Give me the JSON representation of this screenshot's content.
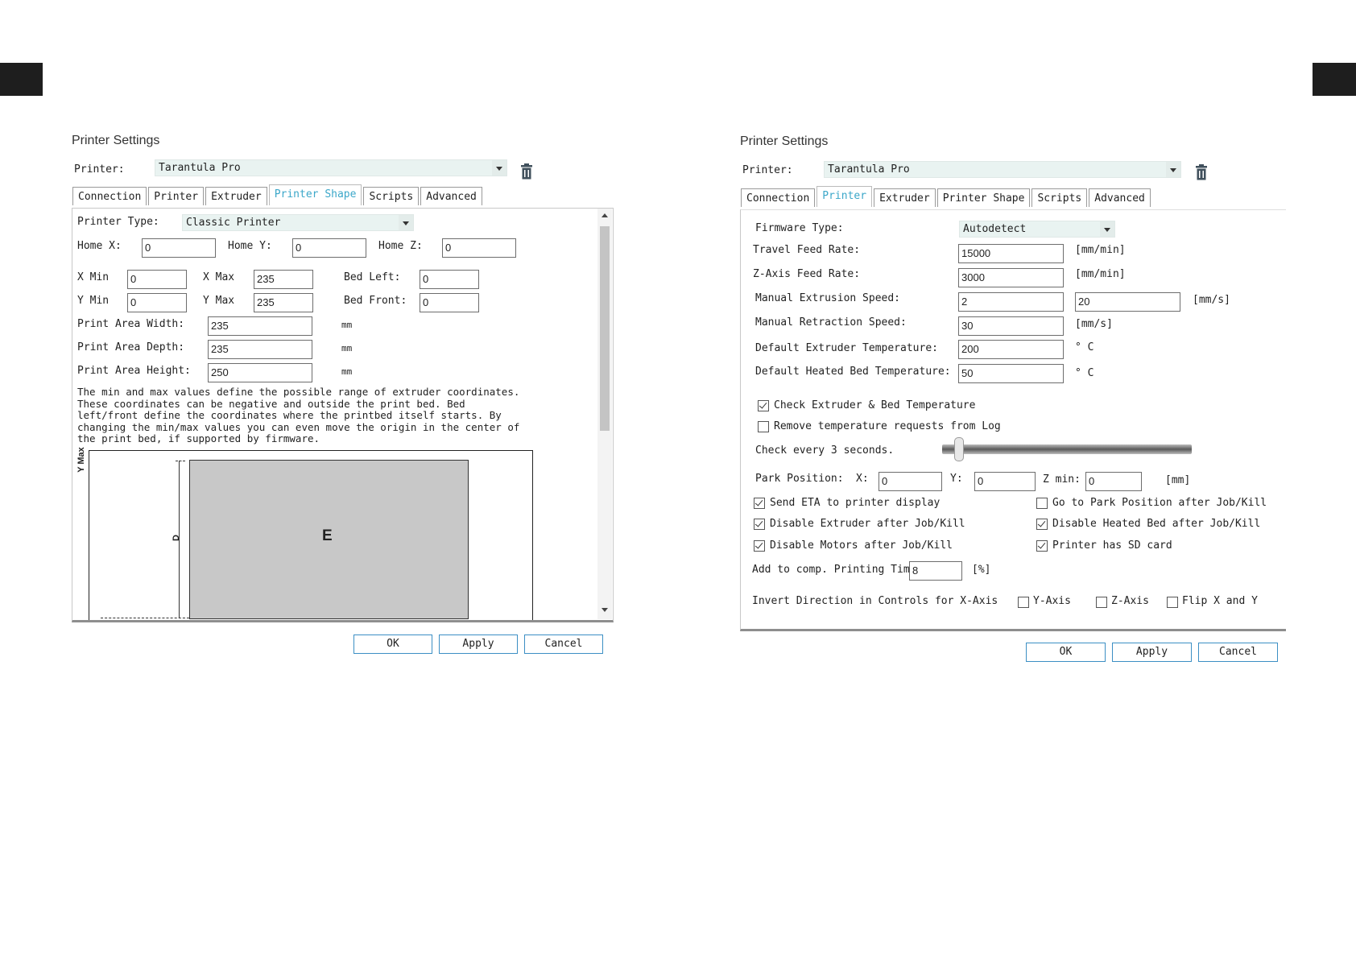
{
  "left": {
    "title": "Printer Settings",
    "printer_label": "Printer:",
    "printer_value": "Tarantula Pro",
    "tabs": [
      {
        "label": "Connection",
        "active": false
      },
      {
        "label": "Printer",
        "active": false
      },
      {
        "label": "Extruder",
        "active": false
      },
      {
        "label": "Printer Shape",
        "active": true
      },
      {
        "label": "Scripts",
        "active": false
      },
      {
        "label": "Advanced",
        "active": false
      }
    ],
    "printer_type_label": "Printer Type:",
    "printer_type_value": "Classic Printer",
    "home_x_label": "Home X:",
    "home_x": "0",
    "home_y_label": "Home Y:",
    "home_y": "0",
    "home_z_label": "Home Z:",
    "home_z": "0",
    "x_min_label": "X Min",
    "x_min": "0",
    "x_max_label": "X Max",
    "x_max": "235",
    "bed_left_label": "Bed Left:",
    "bed_left": "0",
    "y_min_label": "Y Min",
    "y_min": "0",
    "y_max_label": "Y Max",
    "y_max": "235",
    "bed_front_label": "Bed Front:",
    "bed_front": "0",
    "width_label": "Print Area Width:",
    "width": "235",
    "depth_label": "Print Area Depth:",
    "depth": "235",
    "height_label": "Print Area Height:",
    "height": "250",
    "unit_mm": "mm",
    "note": "The min and max values define the possible range of extruder coordinates.\nThese coordinates can be negative and outside the print bed. Bed\nleft/front define the coordinates where the printbed itself starts. By\nchanging the min/max values you can even move the origin in the center of\nthe print bed, if supported by firmware.",
    "diagram_ymax": "Y Max",
    "diagram_d": "D",
    "diagram_e": "E",
    "ok": "OK",
    "apply": "Apply",
    "cancel": "Cancel"
  },
  "right": {
    "title": "Printer Settings",
    "printer_label": "Printer:",
    "printer_value": "Tarantula Pro",
    "tabs": [
      {
        "label": "Connection",
        "active": false
      },
      {
        "label": "Printer",
        "active": true
      },
      {
        "label": "Extruder",
        "active": false
      },
      {
        "label": "Printer Shape",
        "active": false
      },
      {
        "label": "Scripts",
        "active": false
      },
      {
        "label": "Advanced",
        "active": false
      }
    ],
    "firmware_label": "Firmware Type:",
    "firmware_value": "Autodetect",
    "travel_label": "Travel Feed Rate:",
    "travel": "15000",
    "travel_unit": "[mm/min]",
    "zaxis_label": "Z-Axis Feed Rate:",
    "zaxis": "3000",
    "zaxis_unit": "[mm/min]",
    "extrusion_label": "Manual Extrusion Speed:",
    "extrusion_min": "2",
    "extrusion_max": "20",
    "extrusion_unit": "[mm/s]",
    "retraction_label": "Manual Retraction Speed:",
    "retraction": "30",
    "retraction_unit": "[mm/s]",
    "ext_temp_label": "Default Extruder Temperature:",
    "ext_temp": "200",
    "ext_temp_unit": "° C",
    "bed_temp_label": "Default Heated Bed Temperature:",
    "bed_temp": "50",
    "bed_temp_unit": "° C",
    "check_temp_label": "Check Extruder & Bed Temperature",
    "check_temp": true,
    "remove_temp_label": "Remove temperature requests from Log",
    "remove_temp": false,
    "check_every_label": "Check every 3 seconds.",
    "check_every_slider": 0.05,
    "park_label": "Park Position:",
    "park_x_label": "X:",
    "park_x": "0",
    "park_y_label": "Y:",
    "park_y": "0",
    "park_z_label": "Z min:",
    "park_z": "0",
    "park_unit": "[mm]",
    "send_eta_label": "Send ETA to printer display",
    "send_eta": true,
    "go_park_label": "Go to Park Position after Job/Kill",
    "go_park": false,
    "disable_ext_label": "Disable Extruder after Job/Kill",
    "disable_ext": true,
    "disable_bed_label": "Disable Heated Bed after Job/Kill",
    "disable_bed": true,
    "disable_motors_label": "Disable Motors after Job/Kill",
    "disable_motors": true,
    "sd_card_label": "Printer has SD card",
    "sd_card": true,
    "add_comp_label": "Add to comp. Printing Time",
    "add_comp": "8",
    "add_comp_unit": "[%]",
    "invert_label": "Invert Direction in Controls for X-Axis",
    "invert_y_label": "Y-Axis",
    "invert_z_label": "Z-Axis",
    "flip_label": "Flip X and Y",
    "ok": "OK",
    "apply": "Apply",
    "cancel": "Cancel"
  }
}
